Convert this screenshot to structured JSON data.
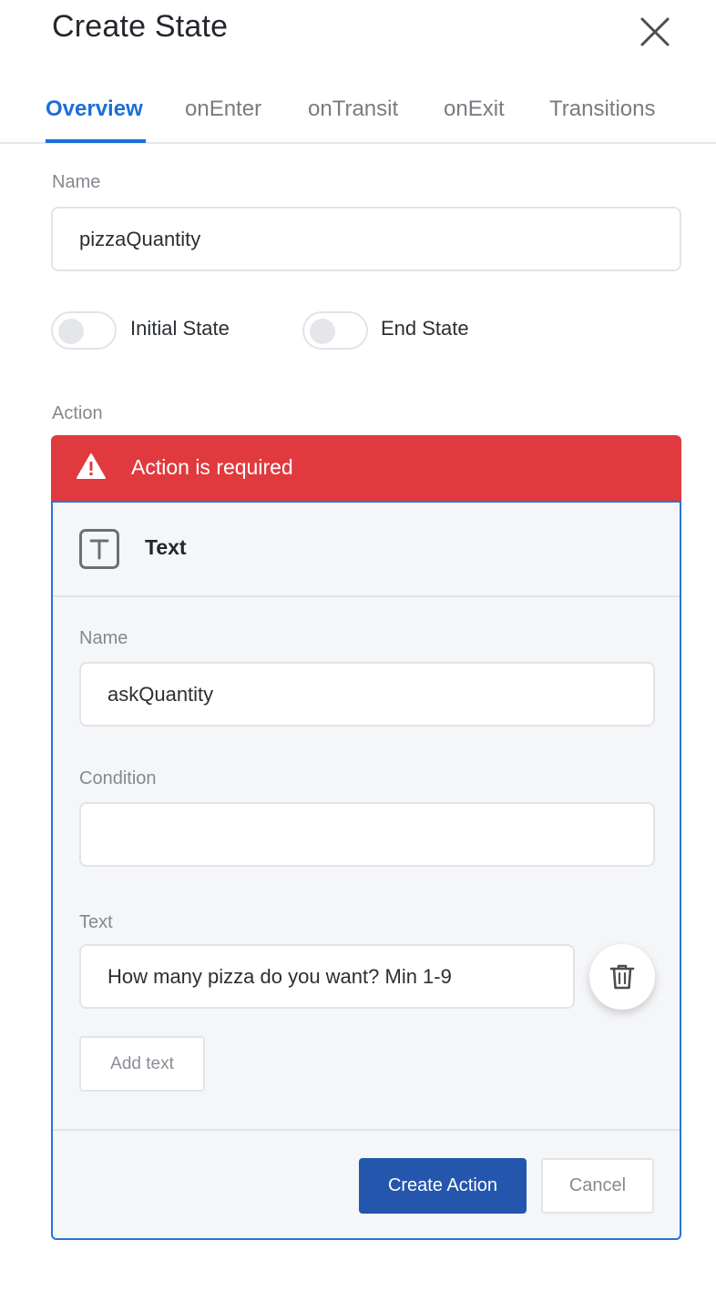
{
  "header": {
    "title": "Create State",
    "close_icon": "close-icon"
  },
  "tabs": [
    {
      "label": "Overview",
      "active": true
    },
    {
      "label": "onEnter",
      "active": false
    },
    {
      "label": "onTransit",
      "active": false
    },
    {
      "label": "onExit",
      "active": false
    },
    {
      "label": "Transitions",
      "active": false
    }
  ],
  "state": {
    "name_label": "Name",
    "name_value": "pizzaQuantity",
    "initial_state_label": "Initial State",
    "initial_state_on": false,
    "end_state_label": "End State",
    "end_state_on": false
  },
  "action": {
    "section_label": "Action",
    "error_icon": "warning-icon",
    "error_text": "Action is required",
    "card": {
      "type_icon": "text-type-icon",
      "type_title": "Text",
      "name_label": "Name",
      "name_value": "askQuantity",
      "condition_label": "Condition",
      "condition_value": "",
      "text_label": "Text",
      "text_value": "How many pizza do you want? Min 1-9",
      "delete_icon": "trash-icon",
      "add_text_label": "Add text",
      "create_label": "Create Action",
      "cancel_label": "Cancel"
    }
  },
  "colors": {
    "accent": "#1b6fd6",
    "error": "#e03a3e",
    "primary_button": "#2556ad",
    "card_border": "#2872d9"
  }
}
